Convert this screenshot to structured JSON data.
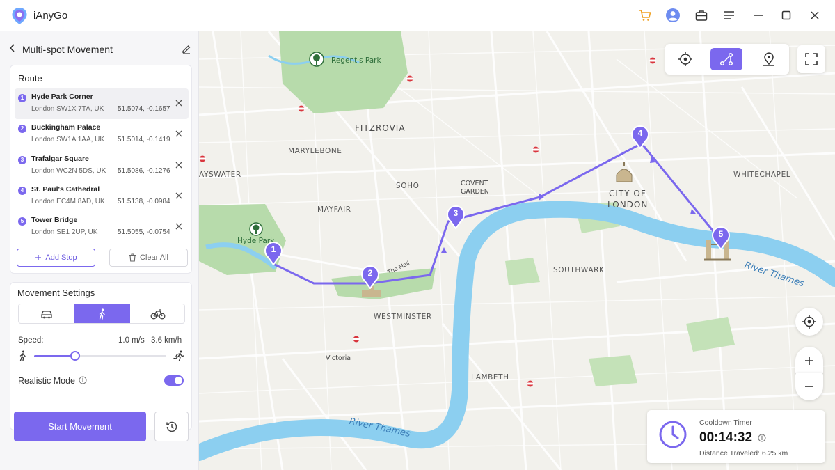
{
  "app": {
    "name": "iAnyGo",
    "brand_color": "#7b68ee",
    "title_icons": [
      "cart-icon",
      "user-icon",
      "toolbox-icon",
      "menu-icon",
      "minimize-icon",
      "maximize-icon",
      "close-icon"
    ]
  },
  "panel": {
    "title": "Multi-spot Movement",
    "route": {
      "title": "Route",
      "stops": [
        {
          "num": "1",
          "name": "Hyde Park Corner",
          "address": "London SW1X 7TA, UK",
          "coords": "51.5074, -0.1657"
        },
        {
          "num": "2",
          "name": "Buckingham Palace",
          "address": "London SW1A 1AA, UK",
          "coords": "51.5014, -0.1419"
        },
        {
          "num": "3",
          "name": "Trafalgar Square",
          "address": "London WC2N 5DS, UK",
          "coords": "51.5086, -0.1276"
        },
        {
          "num": "4",
          "name": "St. Paul's Cathedral",
          "address": "London EC4M 8AD, UK",
          "coords": "51.5138, -0.0984"
        },
        {
          "num": "5",
          "name": "Tower Bridge",
          "address": "London SE1 2UP, UK",
          "coords": "51.5055, -0.0754"
        }
      ],
      "add_stop": "Add Stop",
      "clear_all": "Clear All"
    },
    "movement": {
      "title": "Movement Settings",
      "modes": [
        "car",
        "walk",
        "bike"
      ],
      "active_mode": "walk",
      "speed_label": "Speed:",
      "speed_ms": "1.0 m/s",
      "speed_kmh": "3.6 km/h",
      "speed_fraction": 0.31,
      "realistic_label": "Realistic Mode",
      "realistic_on": true
    },
    "start_button": "Start Movement"
  },
  "map": {
    "labels": {
      "regents_park": "Regent's Park",
      "fitzrovia": "FITZROVIA",
      "marylebone": "MARYLEBONE",
      "bayswater": "AYSWATER",
      "soho": "SOHO",
      "covent": "COVENT",
      "garden": "GARDEN",
      "city_of": "CITY OF",
      "london": "LONDON",
      "whitechapel": "WHITECHAPEL",
      "mayfair": "MAYFAIR",
      "hyde_park": "Hyde Park",
      "the_mall": "The Mall",
      "southwark": "SOUTHWARK",
      "westminster": "WESTMINSTER",
      "victoria": "Victoria",
      "lambeth": "LAMBETH",
      "river_east": "River Thames",
      "river_south": "River Thames"
    },
    "pins": [
      "1",
      "2",
      "3",
      "4",
      "5"
    ],
    "toolbar": [
      "teleport-mode",
      "multi-spot-mode",
      "single-spot-mode"
    ]
  },
  "timer": {
    "label": "Cooldown Timer",
    "value": "00:14:32",
    "distance": "Distance Traveled: 6.25 km"
  }
}
